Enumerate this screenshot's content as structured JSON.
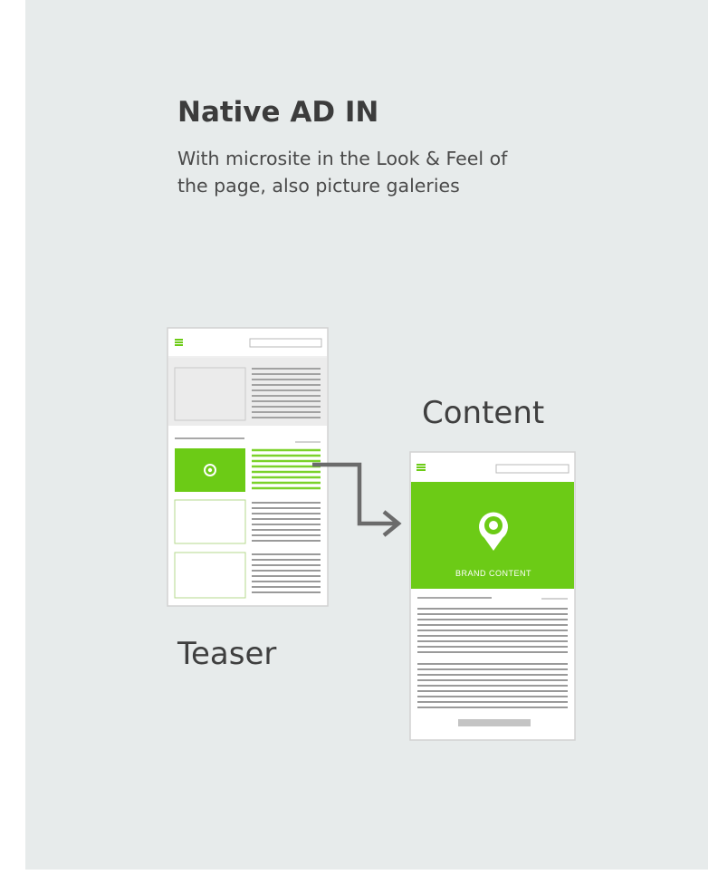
{
  "heading": {
    "title": "Native AD IN",
    "description": "With microsite in the Look & Feel of the page, also picture galeries"
  },
  "teaser": {
    "label": "Teaser"
  },
  "content": {
    "label": "Content",
    "brand_label": "BRAND CONTENT"
  },
  "colors": {
    "background": "#e7ebeb",
    "accent_green": "#6ccb16",
    "arrow": "#6b6b6b",
    "text_lines": "#9a9a9a"
  },
  "icons": {
    "location_pin": "location-pin-icon",
    "hamburger_menu": "hamburger-menu-icon",
    "arrow": "arrow-right-icon"
  }
}
